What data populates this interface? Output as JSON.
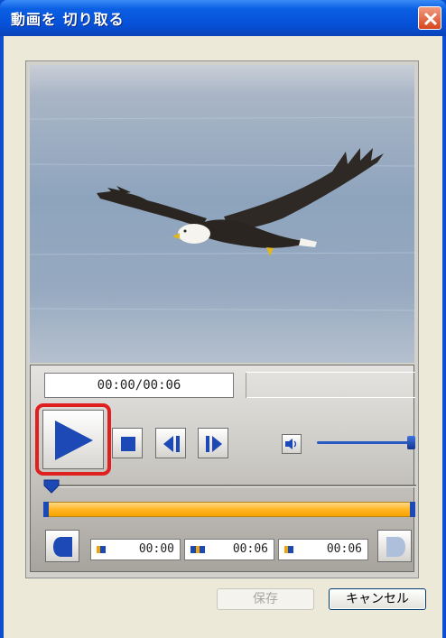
{
  "window": {
    "title": "動画を 切り取る"
  },
  "video": {
    "subject": "eagle-in-flight"
  },
  "player": {
    "time_display": "00:00/00:06",
    "volume_level_pct": 100,
    "seek_position_pct": 0
  },
  "trim": {
    "start_time": "00:00",
    "end_time": "00:06",
    "duration": "00:06"
  },
  "buttons": {
    "save_label": "保存",
    "cancel_label": "キャンセル"
  },
  "colors": {
    "titlebar": "#0650d7",
    "highlight": "#e0201f",
    "accent": "#1c49b5",
    "range": "#ffb624"
  }
}
